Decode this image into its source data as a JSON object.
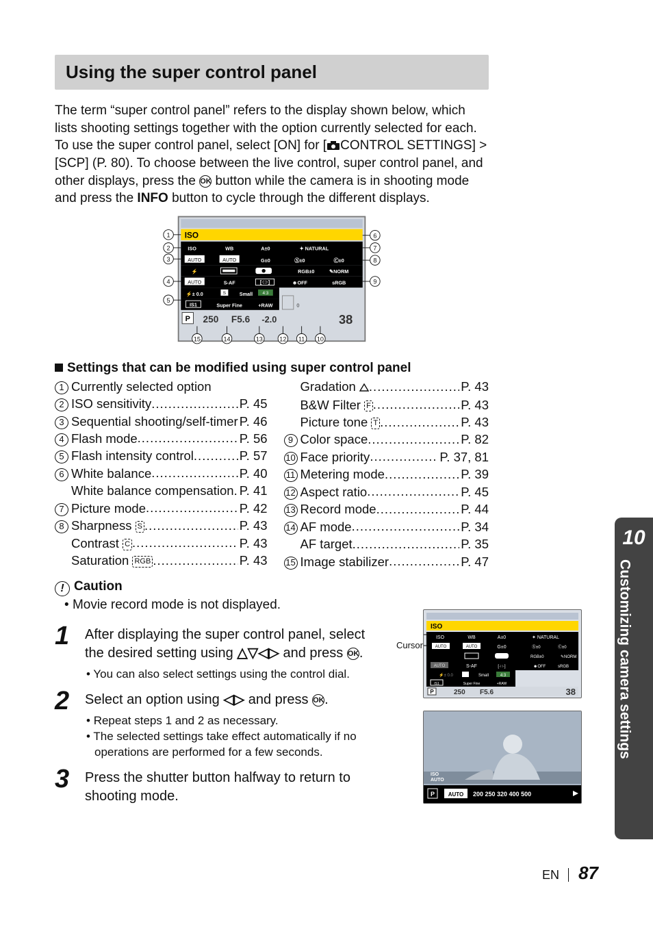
{
  "title": "Using the super control panel",
  "intro": [
    "The term “super control panel” refers to the display shown below, which lists shooting settings together with the option currently selected for each.",
    "To use the super control panel, select [ON] for [",
    "CONTROL SETTINGS] > [SCP] (P. 80). To choose between the live control, super control panel, and other displays, press the ",
    " button while the camera is in shooting mode and press the ",
    " button to cycle through the different displays."
  ],
  "infoWord": "INFO",
  "okLabel": "OK",
  "settingsHeading": "Settings that can be modified using super control panel",
  "leftCol": [
    {
      "num": "1",
      "label": "Currently selected option",
      "page": ""
    },
    {
      "num": "2",
      "label": "ISO sensitivity",
      "page": "P. 45"
    },
    {
      "num": "3",
      "label": "Sequential shooting/self-timer",
      "page": "P. 46"
    },
    {
      "num": "4",
      "label": "Flash mode",
      "page": "P. 56"
    },
    {
      "num": "5",
      "label": "Flash intensity control",
      "page": "P. 57"
    },
    {
      "num": "6",
      "label": "White balance",
      "page": "P. 40"
    },
    {
      "num": "",
      "label": "White balance compensation",
      "page": "P. 41",
      "indent": true
    },
    {
      "num": "7",
      "label": "Picture mode",
      "page": "P. 42"
    },
    {
      "num": "8",
      "label": "Sharpness",
      "page": "P. 43",
      "iconAfter": "S"
    },
    {
      "num": "",
      "label": "Contrast",
      "page": "P. 43",
      "indent": true,
      "iconAfter": "C"
    },
    {
      "num": "",
      "label": "Saturation",
      "page": "P. 43",
      "indent": true,
      "iconAfter": "RGB"
    }
  ],
  "rightCol": [
    {
      "num": "",
      "label": "Gradation",
      "page": "P. 43",
      "indent": true,
      "iconAfter": "grad"
    },
    {
      "num": "",
      "label": "B&W Filter",
      "page": "P. 43",
      "indent": true,
      "iconAfter": "F"
    },
    {
      "num": "",
      "label": "Picture tone",
      "page": "P. 43",
      "indent": true,
      "iconAfter": "T"
    },
    {
      "num": "9",
      "label": "Color space",
      "page": "P. 82"
    },
    {
      "num": "10",
      "label": "Face priority",
      "page": "P. 37, 81"
    },
    {
      "num": "11",
      "label": "Metering mode",
      "page": "P. 39"
    },
    {
      "num": "12",
      "label": "Aspect ratio",
      "page": "P. 45"
    },
    {
      "num": "13",
      "label": "Record mode",
      "page": "P. 44"
    },
    {
      "num": "14",
      "label": "AF mode",
      "page": "P. 34"
    },
    {
      "num": "",
      "label": "AF target",
      "page": "P. 35",
      "indent": true
    },
    {
      "num": "15",
      "label": "Image stabilizer",
      "page": "P. 47"
    }
  ],
  "cautionTitle": "Caution",
  "cautionText": "Movie record mode is not displayed.",
  "steps": [
    {
      "n": "1",
      "body": "After displaying the super control panel, select the desired setting using ",
      "bodyAfter": " and press ",
      "subs": [
        "You can also select settings using the control dial."
      ]
    },
    {
      "n": "2",
      "body": "Select an option using ",
      "bodyAfter": " and press ",
      "subs": [
        "Repeat steps 1 and 2 as necessary.",
        "The selected settings take effect automatically if no operations are performed for a few seconds."
      ]
    },
    {
      "n": "3",
      "body": "Press the shutter button halfway to return to shooting mode.",
      "subs": []
    }
  ],
  "cursorLabel": "Cursor",
  "scpFig": {
    "iso": "ISO",
    "cols": [
      "ISO",
      "WB",
      "A±0"
    ],
    "auto": "AUTO",
    "gpm0": "G±0",
    "natural": "NATURAL",
    "sAf": "S-AF",
    "rgbpm0": "±0",
    "norm": "NORM",
    "small": "Small",
    "ratio": "4:3",
    "rec": "Super Fine",
    "raw": "+RAW",
    "off": "OFF",
    "srgb": "sRGB",
    "pm00": "± 0.0",
    "is1": "IS1",
    "p": "P",
    "shutter": "250",
    "fnum": "F5.6",
    "ev": "-2.0",
    "shots": "38",
    "spm0a": "±0",
    "spm0b": "±0"
  },
  "smallFig2": {
    "p": "P",
    "isoAuto": "ISO\nAUTO",
    "autoBox": "AUTO",
    "isoVals": "200  250 320 400 500"
  },
  "sideTab": {
    "num": "10",
    "label": "Customizing camera settings"
  },
  "footer": {
    "lang": "EN",
    "page": "87"
  }
}
